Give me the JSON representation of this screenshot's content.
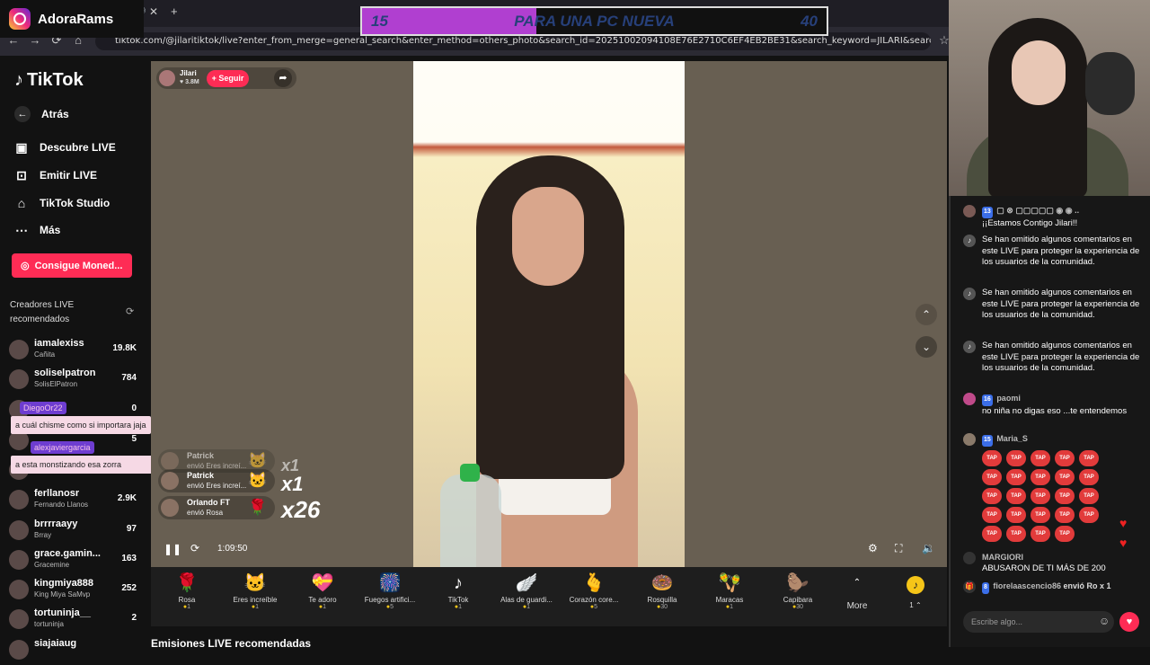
{
  "browser": {
    "url": "tiktok.com/@jilaritiktok/live?enter_from_merge=general_search&enter_method=others_photo&search_id=20251002094108E76E2710C6EF4EB2BE31&search_keyword=JILARI&search_result_id=6702607865871483910&s..."
  },
  "overlay": {
    "brand_name": "AdoraRams",
    "goal_current": "15",
    "goal_label": "PARA UNA PC NUEVA",
    "goal_target": "40",
    "goal_progress": 0.375
  },
  "sidebar": {
    "logo": "TikTok",
    "back_label": "Atrás",
    "nav": [
      {
        "label": "Descubre LIVE",
        "icon": "live-discover-icon"
      },
      {
        "label": "Emitir LIVE",
        "icon": "broadcast-icon"
      },
      {
        "label": "TikTok Studio",
        "icon": "studio-icon"
      },
      {
        "label": "Más",
        "icon": "more-icon"
      }
    ],
    "coins_button": "Consigue Moned...",
    "section_title": "Creadores LIVE recomendados",
    "creators": [
      {
        "name": "iamalexiss",
        "sub": "Cañita",
        "count": "19.8K"
      },
      {
        "name": "soliselpatron",
        "sub": "SolisElPatron",
        "count": "784"
      },
      {
        "name": "",
        "sub": "",
        "count": "0"
      },
      {
        "name": "",
        "sub": "",
        "count": "5"
      },
      {
        "name": "",
        "sub": "",
        "count": ""
      },
      {
        "name": "ferllanosr",
        "sub": "Fernando Llanos",
        "count": "2.9K"
      },
      {
        "name": "brrrraayy",
        "sub": "Brray",
        "count": "97"
      },
      {
        "name": "grace.gamin...",
        "sub": "Gracemine",
        "count": "163"
      },
      {
        "name": "kingmiya888",
        "sub": "King Miya SaMvp",
        "count": "252"
      },
      {
        "name": "tortuninja__",
        "sub": "tortuninja",
        "count": "2"
      },
      {
        "name": "siajaiaug",
        "sub": "",
        "count": ""
      }
    ],
    "overlay_chat": [
      {
        "user": "DiegoOr22",
        "text": "a cuál chisme como si importara jaja"
      },
      {
        "user": "alexjaviergarcia",
        "text": "a esta monstizando esa zorra"
      }
    ]
  },
  "stream": {
    "host_name": "Jilari",
    "host_likes": "3.8M",
    "follow_label": "+ Seguir",
    "elapsed": "1:09:50",
    "gift_feed": [
      {
        "user": "Patrick",
        "action": "envió Eres increí...",
        "mult": "x1"
      },
      {
        "user": "Patrick",
        "action": "envió Eres increí...",
        "mult": "x1"
      },
      {
        "user": "Orlando FT",
        "action": "envió Rosa",
        "mult": "x26"
      }
    ]
  },
  "gifts": [
    {
      "name": "Rosa",
      "price": "1",
      "icon": "rose-icon",
      "glyph": "🌹"
    },
    {
      "name": "Eres increíble",
      "price": "1",
      "icon": "cat-icon",
      "glyph": "🐱"
    },
    {
      "name": "Te adoro",
      "price": "1",
      "icon": "heart-gift-icon",
      "glyph": "💝"
    },
    {
      "name": "Fuegos artifici...",
      "price": "5",
      "icon": "fireworks-icon",
      "glyph": "🎆"
    },
    {
      "name": "TikTok",
      "price": "1",
      "icon": "tiktok-gift-icon",
      "glyph": "♪"
    },
    {
      "name": "Alas de guardi...",
      "price": "1",
      "icon": "wings-icon",
      "glyph": "🪽"
    },
    {
      "name": "Corazón core...",
      "price": "5",
      "icon": "hand-heart-icon",
      "glyph": "🫰"
    },
    {
      "name": "Rosquilla",
      "price": "30",
      "icon": "donut-icon",
      "glyph": "🍩"
    },
    {
      "name": "Maracas",
      "price": "1",
      "icon": "maracas-icon",
      "glyph": "🪇"
    },
    {
      "name": "Capibara",
      "price": "30",
      "icon": "capybara-icon",
      "glyph": "🦫"
    }
  ],
  "more_label": "More",
  "balance": "1",
  "recs_title": "Emisiones LIVE recomendadas",
  "chat": {
    "messages": [
      {
        "head": "13",
        "text": "¡¡Estamos Contigo Jilari!!"
      },
      {
        "head": "",
        "text": "Se han omitido algunos comentarios en este LIVE para proteger la experiencia de los usuarios de la comunidad."
      },
      {
        "head": "",
        "text": "Se han omitido algunos comentarios en este LIVE para proteger la experiencia de los usuarios de la comunidad."
      },
      {
        "head": "",
        "text": "Se han omitido algunos comentarios en este LIVE para proteger la experiencia de los usuarios de la comunidad."
      },
      {
        "head": "paomi",
        "badge": "16",
        "text": "no niña no digas eso ...te entendemos"
      },
      {
        "head": "Maria_S",
        "badge": "15",
        "text": ""
      },
      {
        "head": "MARGIORI",
        "text": "ABUSARON DE TI MÁS DE 200"
      },
      {
        "head": "fiorelaascencio86",
        "badge": "8",
        "text": "envió Ro x 1"
      }
    ],
    "tap_label": "TAP",
    "input_placeholder": "Escribe algo..."
  }
}
